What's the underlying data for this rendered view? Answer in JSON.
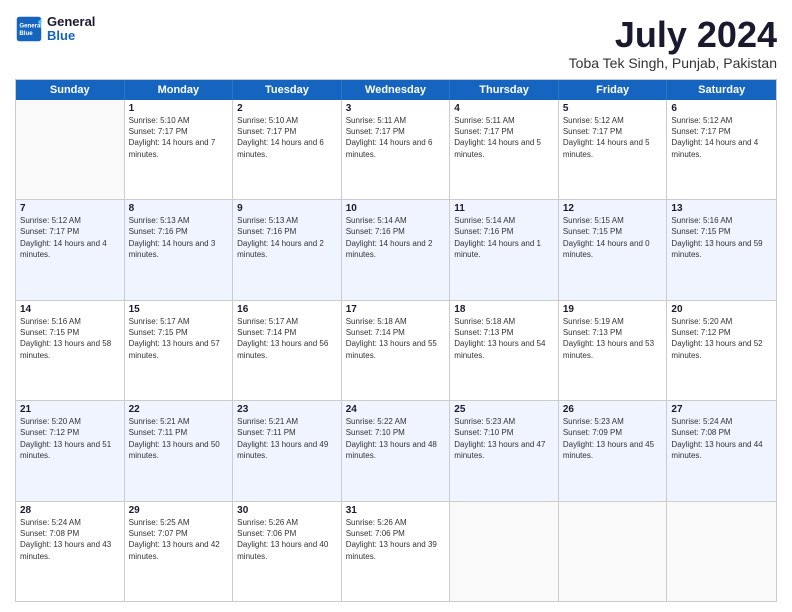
{
  "logo": {
    "line1": "General",
    "line2": "Blue"
  },
  "title": "July 2024",
  "location": "Toba Tek Singh, Punjab, Pakistan",
  "days_of_week": [
    "Sunday",
    "Monday",
    "Tuesday",
    "Wednesday",
    "Thursday",
    "Friday",
    "Saturday"
  ],
  "weeks": [
    [
      {
        "day": "",
        "sunrise": "",
        "sunset": "",
        "daylight": ""
      },
      {
        "day": "1",
        "sunrise": "Sunrise: 5:10 AM",
        "sunset": "Sunset: 7:17 PM",
        "daylight": "Daylight: 14 hours and 7 minutes."
      },
      {
        "day": "2",
        "sunrise": "Sunrise: 5:10 AM",
        "sunset": "Sunset: 7:17 PM",
        "daylight": "Daylight: 14 hours and 6 minutes."
      },
      {
        "day": "3",
        "sunrise": "Sunrise: 5:11 AM",
        "sunset": "Sunset: 7:17 PM",
        "daylight": "Daylight: 14 hours and 6 minutes."
      },
      {
        "day": "4",
        "sunrise": "Sunrise: 5:11 AM",
        "sunset": "Sunset: 7:17 PM",
        "daylight": "Daylight: 14 hours and 5 minutes."
      },
      {
        "day": "5",
        "sunrise": "Sunrise: 5:12 AM",
        "sunset": "Sunset: 7:17 PM",
        "daylight": "Daylight: 14 hours and 5 minutes."
      },
      {
        "day": "6",
        "sunrise": "Sunrise: 5:12 AM",
        "sunset": "Sunset: 7:17 PM",
        "daylight": "Daylight: 14 hours and 4 minutes."
      }
    ],
    [
      {
        "day": "7",
        "sunrise": "Sunrise: 5:12 AM",
        "sunset": "Sunset: 7:17 PM",
        "daylight": "Daylight: 14 hours and 4 minutes."
      },
      {
        "day": "8",
        "sunrise": "Sunrise: 5:13 AM",
        "sunset": "Sunset: 7:16 PM",
        "daylight": "Daylight: 14 hours and 3 minutes."
      },
      {
        "day": "9",
        "sunrise": "Sunrise: 5:13 AM",
        "sunset": "Sunset: 7:16 PM",
        "daylight": "Daylight: 14 hours and 2 minutes."
      },
      {
        "day": "10",
        "sunrise": "Sunrise: 5:14 AM",
        "sunset": "Sunset: 7:16 PM",
        "daylight": "Daylight: 14 hours and 2 minutes."
      },
      {
        "day": "11",
        "sunrise": "Sunrise: 5:14 AM",
        "sunset": "Sunset: 7:16 PM",
        "daylight": "Daylight: 14 hours and 1 minute."
      },
      {
        "day": "12",
        "sunrise": "Sunrise: 5:15 AM",
        "sunset": "Sunset: 7:15 PM",
        "daylight": "Daylight: 14 hours and 0 minutes."
      },
      {
        "day": "13",
        "sunrise": "Sunrise: 5:16 AM",
        "sunset": "Sunset: 7:15 PM",
        "daylight": "Daylight: 13 hours and 59 minutes."
      }
    ],
    [
      {
        "day": "14",
        "sunrise": "Sunrise: 5:16 AM",
        "sunset": "Sunset: 7:15 PM",
        "daylight": "Daylight: 13 hours and 58 minutes."
      },
      {
        "day": "15",
        "sunrise": "Sunrise: 5:17 AM",
        "sunset": "Sunset: 7:15 PM",
        "daylight": "Daylight: 13 hours and 57 minutes."
      },
      {
        "day": "16",
        "sunrise": "Sunrise: 5:17 AM",
        "sunset": "Sunset: 7:14 PM",
        "daylight": "Daylight: 13 hours and 56 minutes."
      },
      {
        "day": "17",
        "sunrise": "Sunrise: 5:18 AM",
        "sunset": "Sunset: 7:14 PM",
        "daylight": "Daylight: 13 hours and 55 minutes."
      },
      {
        "day": "18",
        "sunrise": "Sunrise: 5:18 AM",
        "sunset": "Sunset: 7:13 PM",
        "daylight": "Daylight: 13 hours and 54 minutes."
      },
      {
        "day": "19",
        "sunrise": "Sunrise: 5:19 AM",
        "sunset": "Sunset: 7:13 PM",
        "daylight": "Daylight: 13 hours and 53 minutes."
      },
      {
        "day": "20",
        "sunrise": "Sunrise: 5:20 AM",
        "sunset": "Sunset: 7:12 PM",
        "daylight": "Daylight: 13 hours and 52 minutes."
      }
    ],
    [
      {
        "day": "21",
        "sunrise": "Sunrise: 5:20 AM",
        "sunset": "Sunset: 7:12 PM",
        "daylight": "Daylight: 13 hours and 51 minutes."
      },
      {
        "day": "22",
        "sunrise": "Sunrise: 5:21 AM",
        "sunset": "Sunset: 7:11 PM",
        "daylight": "Daylight: 13 hours and 50 minutes."
      },
      {
        "day": "23",
        "sunrise": "Sunrise: 5:21 AM",
        "sunset": "Sunset: 7:11 PM",
        "daylight": "Daylight: 13 hours and 49 minutes."
      },
      {
        "day": "24",
        "sunrise": "Sunrise: 5:22 AM",
        "sunset": "Sunset: 7:10 PM",
        "daylight": "Daylight: 13 hours and 48 minutes."
      },
      {
        "day": "25",
        "sunrise": "Sunrise: 5:23 AM",
        "sunset": "Sunset: 7:10 PM",
        "daylight": "Daylight: 13 hours and 47 minutes."
      },
      {
        "day": "26",
        "sunrise": "Sunrise: 5:23 AM",
        "sunset": "Sunset: 7:09 PM",
        "daylight": "Daylight: 13 hours and 45 minutes."
      },
      {
        "day": "27",
        "sunrise": "Sunrise: 5:24 AM",
        "sunset": "Sunset: 7:08 PM",
        "daylight": "Daylight: 13 hours and 44 minutes."
      }
    ],
    [
      {
        "day": "28",
        "sunrise": "Sunrise: 5:24 AM",
        "sunset": "Sunset: 7:08 PM",
        "daylight": "Daylight: 13 hours and 43 minutes."
      },
      {
        "day": "29",
        "sunrise": "Sunrise: 5:25 AM",
        "sunset": "Sunset: 7:07 PM",
        "daylight": "Daylight: 13 hours and 42 minutes."
      },
      {
        "day": "30",
        "sunrise": "Sunrise: 5:26 AM",
        "sunset": "Sunset: 7:06 PM",
        "daylight": "Daylight: 13 hours and 40 minutes."
      },
      {
        "day": "31",
        "sunrise": "Sunrise: 5:26 AM",
        "sunset": "Sunset: 7:06 PM",
        "daylight": "Daylight: 13 hours and 39 minutes."
      },
      {
        "day": "",
        "sunrise": "",
        "sunset": "",
        "daylight": ""
      },
      {
        "day": "",
        "sunrise": "",
        "sunset": "",
        "daylight": ""
      },
      {
        "day": "",
        "sunrise": "",
        "sunset": "",
        "daylight": ""
      }
    ]
  ]
}
